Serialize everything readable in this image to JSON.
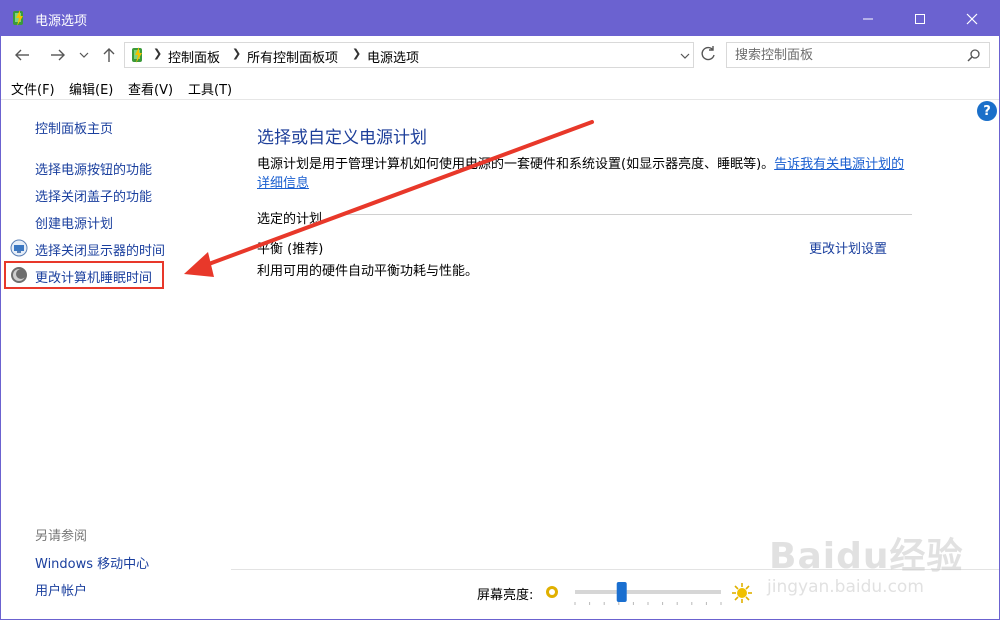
{
  "window": {
    "title": "电源选项",
    "title_bar_color": "#6b62d0"
  },
  "address": {
    "crumbs": [
      "控制面板",
      "所有控制面板项",
      "电源选项"
    ],
    "search_placeholder": "搜索控制面板"
  },
  "menu": {
    "items": [
      "文件(F)",
      "编辑(E)",
      "查看(V)",
      "工具(T)"
    ]
  },
  "help": {
    "label": "?"
  },
  "leftnav": {
    "home": "控制面板主页",
    "links": [
      {
        "label": "选择电源按钮的功能",
        "icon": ""
      },
      {
        "label": "选择关闭盖子的功能",
        "icon": ""
      },
      {
        "label": "创建电源计划",
        "icon": ""
      },
      {
        "label": "选择关闭显示器的时间",
        "icon": "monitor-icon"
      },
      {
        "label": "更改计算机睡眠时间",
        "icon": "sleep-moon-icon"
      }
    ],
    "see_also_label": "另请参阅",
    "see_also": [
      "Windows 移动中心",
      "用户帐户"
    ]
  },
  "main": {
    "title": "选择或自定义电源计划",
    "description": "电源计划是用于管理计算机如何使用电源的一套硬件和系统设置(如显示器亮度、睡眠等)。",
    "learn_more": "告诉我有关电源计划的详细信息",
    "selected_plan_label": "选定的计划",
    "plan": {
      "name": "平衡 (推荐)",
      "description": "利用可用的硬件自动平衡功耗与性能。",
      "settings_link": "更改计划设置"
    }
  },
  "brightness": {
    "label": "屏幕亮度:",
    "level": 0.32
  },
  "watermark": {
    "main": "Baidu经验",
    "sub": "jingyan.baidu.com"
  },
  "colors": {
    "link": "#1a3f9e",
    "title": "#1e3f9a",
    "annotation": "#e8382a",
    "slider_thumb": "#1a6fd0"
  }
}
